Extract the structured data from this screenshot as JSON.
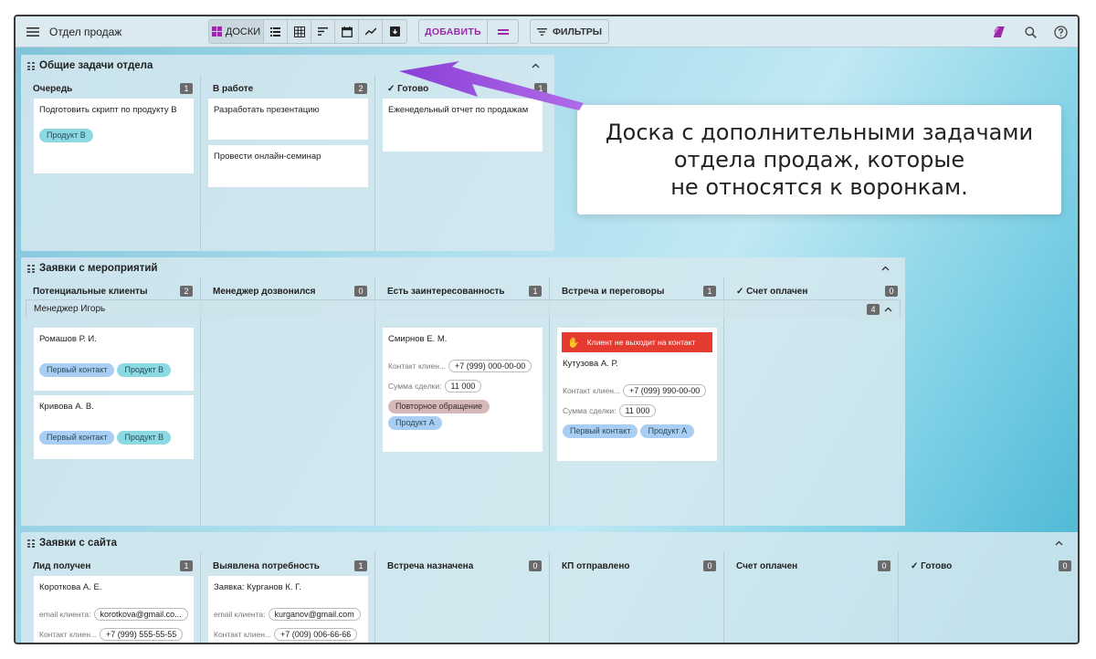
{
  "toolbar": {
    "title": "Отдел продаж",
    "boards_label": "ДОСКИ",
    "add_label": "ДОБАВИТЬ",
    "filters_label": "ФИЛЬТРЫ",
    "accent_color": "#9b2aa8"
  },
  "callout": {
    "line1": "Доска с дополнительными задачами",
    "line2": "отдела продаж, которые",
    "line3": "не относятся к воронкам."
  },
  "board1": {
    "title": "Общие задачи отдела",
    "columns": [
      {
        "name": "Очередь",
        "count": "1"
      },
      {
        "name": "В работе",
        "count": "2"
      },
      {
        "name": "Готово",
        "count": "1"
      }
    ],
    "cards": {
      "c1": "Подготовить скрипт по продукту B",
      "c1_tag": "Продукт B",
      "c2": "Разработать презентацию",
      "c3": "Провести онлайн-семинар",
      "c4": "Еженедельный отчет по продажам"
    }
  },
  "board2": {
    "title": "Заявки с мероприятий",
    "columns": [
      {
        "name": "Потенциальные клиенты",
        "count": "2"
      },
      {
        "name": "Менеджер дозвонился",
        "count": "0"
      },
      {
        "name": "Есть заинтересованность",
        "count": "1"
      },
      {
        "name": "Встреча и переговоры",
        "count": "1"
      },
      {
        "name": "Счет оплачен",
        "count": "0"
      }
    ],
    "group": {
      "name": "Менеджер Игорь",
      "count": "4"
    },
    "cards": {
      "a_name": "Ромашов Р. И.",
      "a_tag1": "Первый контакт",
      "a_tag2": "Продукт B",
      "b_name": "Кривова А. В.",
      "b_tag1": "Первый контакт",
      "b_tag2": "Продукт B",
      "c_name": "Смирнов Е. М.",
      "c_phone_label": "Контакт клиен...",
      "c_phone": "+7 (999) 000-00-00",
      "c_sum_label": "Сумма сделки:",
      "c_sum": "11 000",
      "c_tag1": "Повторное обращение",
      "c_tag2": "Продукт A",
      "d_alert": "Клиент не выходит на контакт",
      "d_name": "Кутузова А. Р.",
      "d_phone_label": "Контакт клиен...",
      "d_phone": "+7 (099) 990-00-00",
      "d_sum_label": "Сумма сделки:",
      "d_sum": "11 000",
      "d_tag1": "Первый контакт",
      "d_tag2": "Продукт A"
    }
  },
  "board3": {
    "title": "Заявки с сайта",
    "columns": [
      {
        "name": "Лид получен",
        "count": "1"
      },
      {
        "name": "Выявлена потребность",
        "count": "1"
      },
      {
        "name": "Встреча назначена",
        "count": "0"
      },
      {
        "name": "КП отправлено",
        "count": "0"
      },
      {
        "name": "Счет оплачен",
        "count": "0"
      },
      {
        "name": "Готово",
        "count": "0"
      }
    ],
    "cards": {
      "a_name": "Короткова А. Е.",
      "a_email_label": "email клиента:",
      "a_email": "korotkova@gmail.co...",
      "a_phone_label": "Контакт клиен...",
      "a_phone": "+7 (999) 555-55-55",
      "b_name": "Заявка: Курганов К. Г.",
      "b_email_label": "email клиента:",
      "b_email": "kurganov@gmail.com",
      "b_phone_label": "Контакт клиен...",
      "b_phone": "+7 (009) 006-66-66"
    }
  }
}
